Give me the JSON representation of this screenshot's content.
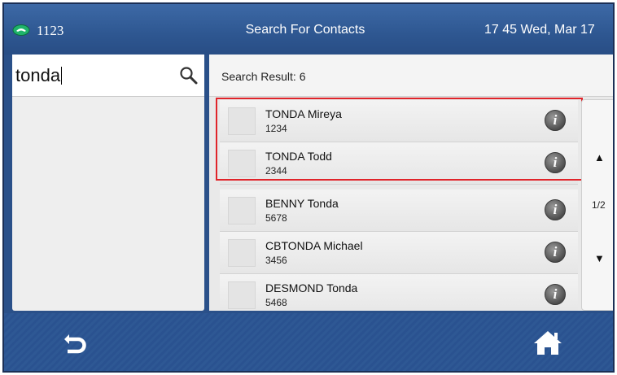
{
  "topbar": {
    "line_number": "1123",
    "title": "Search For Contacts",
    "clock": "17 45  Wed, Mar 17",
    "phone_icon": "phone-icon"
  },
  "search": {
    "value": "tonda",
    "icon": "search-icon"
  },
  "results": {
    "label": "Search Result: 6",
    "contacts": [
      {
        "name": "TONDA Mireya",
        "number": "1234"
      },
      {
        "name": "TONDA Todd",
        "number": "2344"
      },
      {
        "name": "BENNY Tonda",
        "number": "5678"
      },
      {
        "name": "CBTONDA Michael",
        "number": "3456"
      },
      {
        "name": "DESMOND Tonda",
        "number": "5468"
      }
    ],
    "info_icon_glyph": "i"
  },
  "scroller": {
    "up": "▲",
    "page": "1/2",
    "down": "▼"
  },
  "bottombar": {
    "back_icon": "back-icon",
    "home_icon": "home-icon"
  },
  "colors": {
    "bar_blue": "#2e5791",
    "highlight_red": "#e0242a"
  }
}
